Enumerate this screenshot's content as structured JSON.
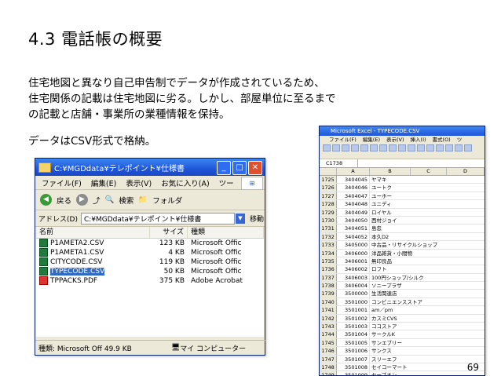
{
  "title": "4.3 電話帳の概要",
  "para1": [
    "住宅地図と異なり自己申告制でデータが作成されているため、",
    "住宅関係の記載は住宅地図に劣る。しかし、部屋単位に至るまで",
    "の記載と店舗・事業所の業種情報を保持。"
  ],
  "para2": "データはCSV形式で格納。",
  "explorer": {
    "title": "C:¥MGDdata¥テレポイント¥仕様書",
    "menu": [
      "ファイル(F)",
      "編集(E)",
      "表示(V)",
      "お気に入り(A)",
      "ツー",
      "»"
    ],
    "toolbar": {
      "back": "戻る",
      "search": "検索",
      "folder": "フォルダ"
    },
    "addr_label": "アドレス(D)",
    "addr_value": "C:¥MGDdata¥テレポイント¥仕様書",
    "go": "移動",
    "headers": [
      "名前",
      "サイズ",
      "種類"
    ],
    "files": [
      {
        "name": "P1AMETA2.CSV",
        "size": "123 KB",
        "type": "Microsoft Offic",
        "icon": "excel-icon"
      },
      {
        "name": "P1AMETA1.CSV",
        "size": "4 KB",
        "type": "Microsoft Offic",
        "icon": "excel-icon"
      },
      {
        "name": "CITYCODE.CSV",
        "size": "119 KB",
        "type": "Microsoft Offic",
        "icon": "excel-icon"
      },
      {
        "name": "TYPECODE.CSV",
        "size": "50 KB",
        "type": "Microsoft Offic",
        "icon": "excel-icon",
        "selected": true
      },
      {
        "name": "TPPACKS.PDF",
        "size": "375 KB",
        "type": "Adobe Acrobat",
        "icon": "pdf-icon"
      }
    ],
    "status_left": "種類: Microsoft Off 49.9 KB",
    "status_right": "マイ コンピューター"
  },
  "excel": {
    "title": "Microsoft Excel - TYPECODE.CSV",
    "menu": [
      "ファイル(F)",
      "編集(E)",
      "表示(V)",
      "挿入(I)",
      "書式(O)",
      "ツ"
    ],
    "namebox": "C1738",
    "cols": [
      "A",
      "B",
      "C",
      "D"
    ],
    "rows": [
      [
        "1725",
        "3404045",
        "ヤマキ"
      ],
      [
        "1726",
        "3404046",
        "ユートク"
      ],
      [
        "1727",
        "3404047",
        "ユーホー"
      ],
      [
        "1728",
        "3404048",
        "ユニディ"
      ],
      [
        "1729",
        "3404049",
        "ロイヤル"
      ],
      [
        "1730",
        "3404050",
        "西村ジョイ"
      ],
      [
        "1731",
        "3404051",
        "島忠"
      ],
      [
        "1732",
        "3404052",
        "本久D2"
      ],
      [
        "1733",
        "3405000",
        "中古品・リサイクルショップ"
      ],
      [
        "1734",
        "3406000",
        "洋品雑貨・小間物"
      ],
      [
        "1735",
        "3406001",
        "無印良品"
      ],
      [
        "1736",
        "3406002",
        "ロフト"
      ],
      [
        "1737",
        "3406003",
        "100円ショップ/シルク"
      ],
      [
        "1738",
        "3406004",
        "ソニープラザ"
      ],
      [
        "1739",
        "3500000",
        "生活関連店"
      ],
      [
        "1740",
        "3501000",
        "コンビニエンスストア"
      ],
      [
        "1741",
        "3501001",
        "am／pm"
      ],
      [
        "1742",
        "3501002",
        "カスミCVS"
      ],
      [
        "1743",
        "3501003",
        "ココストア"
      ],
      [
        "1744",
        "3501004",
        "サークルK"
      ],
      [
        "1745",
        "3501005",
        "サンエブリー"
      ],
      [
        "1746",
        "3501006",
        "サンクス"
      ],
      [
        "1747",
        "3501007",
        "スリーエフ"
      ],
      [
        "1748",
        "3501008",
        "セイコーマート"
      ],
      [
        "1749",
        "3501009",
        "セーブオン"
      ],
      [
        "1750",
        "3501010",
        "セブンイレブン"
      ]
    ]
  },
  "page_number": "69"
}
